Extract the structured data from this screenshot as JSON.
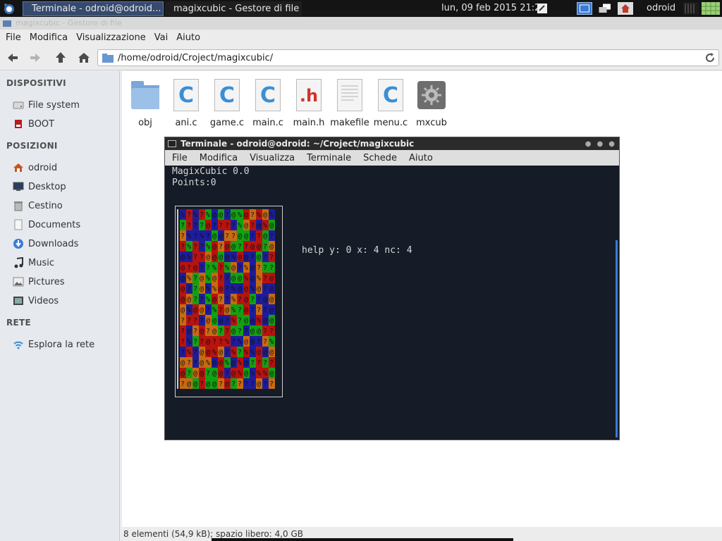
{
  "panel": {
    "tasks": [
      {
        "label": "Terminale - odroid@odroid..."
      },
      {
        "label": "magixcubic - Gestore di file"
      }
    ],
    "clock": "lun, 09 feb 2015 21:24",
    "user": "odroid"
  },
  "filemanager": {
    "title_ghost": "magixcubic - Gestore di file",
    "menu": [
      "File",
      "Modifica",
      "Visualizzazione",
      "Vai",
      "Aiuto"
    ],
    "location": "/home/odroid/Croject/magixcubic/",
    "sidebar": {
      "sections": [
        {
          "title": "DISPOSITIVI",
          "items": [
            {
              "label": "File system",
              "icon": "drive-icon"
            },
            {
              "label": "BOOT",
              "icon": "sdcard-icon"
            }
          ]
        },
        {
          "title": "POSIZIONI",
          "items": [
            {
              "label": "odroid",
              "icon": "home-icon"
            },
            {
              "label": "Desktop",
              "icon": "desktop-icon"
            },
            {
              "label": "Cestino",
              "icon": "trash-icon"
            },
            {
              "label": "Documents",
              "icon": "document-icon"
            },
            {
              "label": "Downloads",
              "icon": "download-icon"
            },
            {
              "label": "Music",
              "icon": "music-icon"
            },
            {
              "label": "Pictures",
              "icon": "picture-icon"
            },
            {
              "label": "Videos",
              "icon": "video-icon"
            }
          ]
        },
        {
          "title": "RETE",
          "items": [
            {
              "label": "Esplora la rete",
              "icon": "network-icon"
            }
          ]
        }
      ]
    },
    "files": [
      {
        "label": "obj",
        "icon": "folder-icon"
      },
      {
        "label": "ani.c",
        "icon": "c-file-icon"
      },
      {
        "label": "game.c",
        "icon": "c-file-icon"
      },
      {
        "label": "main.c",
        "icon": "c-file-icon"
      },
      {
        "label": "main.h",
        "icon": "h-file-icon"
      },
      {
        "label": "makefile",
        "icon": "text-file-icon"
      },
      {
        "label": "menu.c",
        "icon": "c-file-icon"
      },
      {
        "label": "mxcub",
        "icon": "executable-icon"
      }
    ],
    "status": "8 elementi (54,9 kB); spazio libero: 4,0 GB"
  },
  "terminal": {
    "title": "Terminale - odroid@odroid: ~/Croject/magixcubic",
    "menu": [
      "File",
      "Modifica",
      "Visualizza",
      "Terminale",
      "Schede",
      "Aiuto"
    ],
    "line1": "MagixCubic 0.0",
    "line2": "Points:0",
    "help": "help y: 0 x: 4 nc: 4",
    "board_colors": {
      "red": "#b8130f",
      "blue": "#1d1d9c",
      "green": "#13a013",
      "orange": "#c86a12"
    }
  },
  "colors": {
    "accent": "#3a7bd5",
    "terminal_bg": "#151c27",
    "panel_bg": "#141414"
  }
}
